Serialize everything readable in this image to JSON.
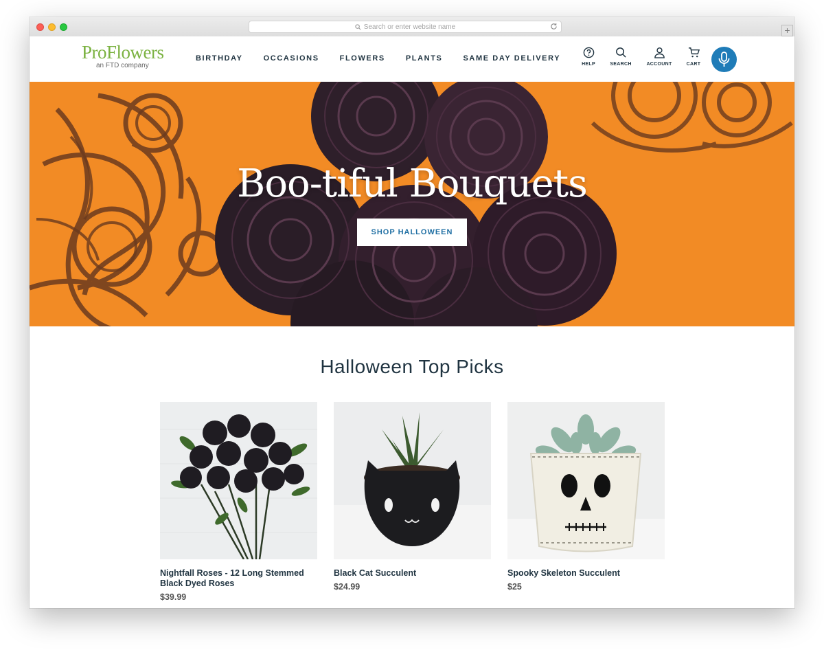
{
  "browser": {
    "address_placeholder": "Search or enter website name"
  },
  "header": {
    "logo_brand": "ProFlowers",
    "logo_sub": "an FTD company",
    "nav": [
      "BIRTHDAY",
      "OCCASIONS",
      "FLOWERS",
      "PLANTS",
      "SAME DAY DELIVERY"
    ],
    "utilities": {
      "help": "HELP",
      "search": "SEARCH",
      "account": "ACCOUNT",
      "cart": "CART"
    }
  },
  "hero": {
    "title": "Boo-tiful Bouquets",
    "button": "SHOP HALLOWEEN"
  },
  "section": {
    "title": "Halloween Top Picks"
  },
  "products": [
    {
      "name": "Nightfall Roses - 12 Long Stemmed Black Dyed Roses",
      "price": "$39.99"
    },
    {
      "name": "Black Cat Succulent",
      "price": "$24.99"
    },
    {
      "name": "Spooky Skeleton Succulent",
      "price": "$25"
    }
  ],
  "colors": {
    "brand_green": "#7bb241",
    "navy_text": "#1f3340",
    "accent_blue": "#1f7cb8",
    "hero_orange": "#f28b25"
  }
}
